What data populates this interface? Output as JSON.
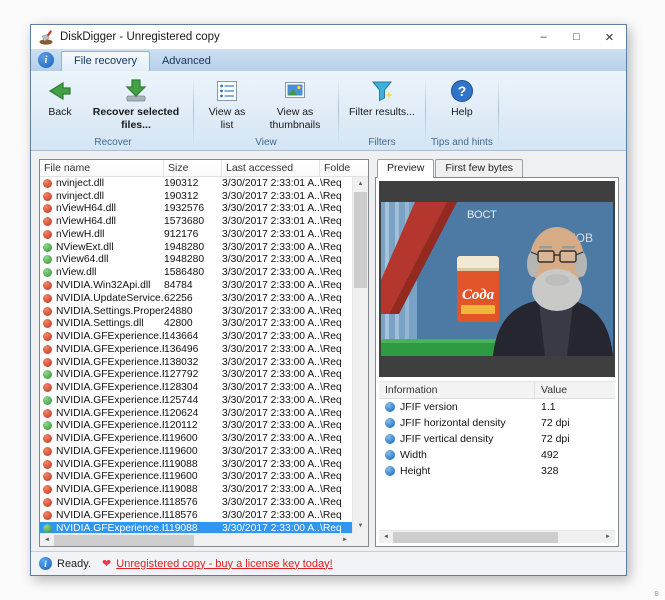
{
  "window": {
    "title": "DiskDigger - Unregistered copy",
    "controls": {
      "minimize": "–",
      "maximize": "□",
      "close": "✕"
    }
  },
  "icons": {
    "info": "i",
    "help": "?",
    "heart": "❤",
    "scroll_up": "▲",
    "scroll_down": "▼",
    "scroll_left": "◄",
    "scroll_right": "►"
  },
  "ribbon": {
    "tabs": [
      {
        "label": "File recovery"
      },
      {
        "label": "Advanced"
      }
    ],
    "groups": [
      {
        "label": "Recover",
        "buttons": [
          {
            "label": "Back"
          },
          {
            "label": "Recover selected files..."
          }
        ]
      },
      {
        "label": "View",
        "buttons": [
          {
            "label": "View as list"
          },
          {
            "label": "View as thumbnails"
          }
        ]
      },
      {
        "label": "Filters",
        "buttons": [
          {
            "label": "Filter results..."
          }
        ]
      },
      {
        "label": "Tips and hints",
        "buttons": [
          {
            "label": "Help"
          }
        ]
      }
    ]
  },
  "file_list": {
    "columns": [
      "File name",
      "Size",
      "Last accessed",
      "Folde"
    ],
    "selected_index": 27,
    "rows": [
      {
        "name": "nvinject.dll",
        "size": "190312",
        "accessed": "3/30/2017 2:33:01 A...",
        "folder": "\\Req",
        "icon": "red"
      },
      {
        "name": "nvinject.dll",
        "size": "190312",
        "accessed": "3/30/2017 2:33:01 A...",
        "folder": "\\Req",
        "icon": "red"
      },
      {
        "name": "nViewH64.dll",
        "size": "1932576",
        "accessed": "3/30/2017 2:33:01 A...",
        "folder": "\\Req",
        "icon": "red"
      },
      {
        "name": "nViewH64.dll",
        "size": "1573680",
        "accessed": "3/30/2017 2:33:01 A...",
        "folder": "\\Req",
        "icon": "red"
      },
      {
        "name": "nViewH.dll",
        "size": "912176",
        "accessed": "3/30/2017 2:33:01 A...",
        "folder": "\\Req",
        "icon": "red"
      },
      {
        "name": "NViewExt.dll",
        "size": "1948280",
        "accessed": "3/30/2017 2:33:00 A...",
        "folder": "\\Req",
        "icon": "green"
      },
      {
        "name": "nView64.dll",
        "size": "1948280",
        "accessed": "3/30/2017 2:33:00 A...",
        "folder": "\\Req",
        "icon": "green"
      },
      {
        "name": "nView.dll",
        "size": "1586480",
        "accessed": "3/30/2017 2:33:00 A...",
        "folder": "\\Req",
        "icon": "green"
      },
      {
        "name": "NVIDIA.Win32Api.dll",
        "size": "84784",
        "accessed": "3/30/2017 2:33:00 A...",
        "folder": "\\Req",
        "icon": "red"
      },
      {
        "name": "NVIDIA.UpdateService.dll",
        "size": "62256",
        "accessed": "3/30/2017 2:33:00 A...",
        "folder": "\\Req",
        "icon": "red"
      },
      {
        "name": "NVIDIA.Settings.Properti...",
        "size": "24880",
        "accessed": "3/30/2017 2:33:00 A...",
        "folder": "\\Req",
        "icon": "red"
      },
      {
        "name": "NVIDIA.Settings.dll",
        "size": "42800",
        "accessed": "3/30/2017 2:33:00 A...",
        "folder": "\\Req",
        "icon": "red"
      },
      {
        "name": "NVIDIA.GFExperience.Re...",
        "size": "143664",
        "accessed": "3/30/2017 2:33:00 A...",
        "folder": "\\Req",
        "icon": "red"
      },
      {
        "name": "NVIDIA.GFExperience.Re...",
        "size": "136496",
        "accessed": "3/30/2017 2:33:00 A...",
        "folder": "\\Req",
        "icon": "red"
      },
      {
        "name": "NVIDIA.GFExperience.Re...",
        "size": "138032",
        "accessed": "3/30/2017 2:33:00 A...",
        "folder": "\\Req",
        "icon": "red"
      },
      {
        "name": "NVIDIA.GFExperience.Re...",
        "size": "127792",
        "accessed": "3/30/2017 2:33:00 A...",
        "folder": "\\Req",
        "icon": "green"
      },
      {
        "name": "NVIDIA.GFExperience.Re...",
        "size": "128304",
        "accessed": "3/30/2017 2:33:00 A...",
        "folder": "\\Req",
        "icon": "red"
      },
      {
        "name": "NVIDIA.GFExperience.Re...",
        "size": "125744",
        "accessed": "3/30/2017 2:33:00 A...",
        "folder": "\\Req",
        "icon": "green"
      },
      {
        "name": "NVIDIA.GFExperience.Re...",
        "size": "120624",
        "accessed": "3/30/2017 2:33:00 A...",
        "folder": "\\Req",
        "icon": "red"
      },
      {
        "name": "NVIDIA.GFExperience.Re...",
        "size": "120112",
        "accessed": "3/30/2017 2:33:00 A...",
        "folder": "\\Req",
        "icon": "green"
      },
      {
        "name": "NVIDIA.GFExperience.Re...",
        "size": "119600",
        "accessed": "3/30/2017 2:33:00 A...",
        "folder": "\\Req",
        "icon": "red"
      },
      {
        "name": "NVIDIA.GFExperience.Re...",
        "size": "119600",
        "accessed": "3/30/2017 2:33:00 A...",
        "folder": "\\Req",
        "icon": "red"
      },
      {
        "name": "NVIDIA.GFExperience.Re...",
        "size": "119088",
        "accessed": "3/30/2017 2:33:00 A...",
        "folder": "\\Req",
        "icon": "red"
      },
      {
        "name": "NVIDIA.GFExperience.Re...",
        "size": "119600",
        "accessed": "3/30/2017 2:33:00 A...",
        "folder": "\\Req",
        "icon": "red"
      },
      {
        "name": "NVIDIA.GFExperience.Re...",
        "size": "119088",
        "accessed": "3/30/2017 2:33:00 A...",
        "folder": "\\Req",
        "icon": "red"
      },
      {
        "name": "NVIDIA.GFExperience.Re...",
        "size": "118576",
        "accessed": "3/30/2017 2:33:00 A...",
        "folder": "\\Req",
        "icon": "red"
      },
      {
        "name": "NVIDIA.GFExperience.Re...",
        "size": "118576",
        "accessed": "3/30/2017 2:33:00 A...",
        "folder": "\\Req",
        "icon": "red"
      },
      {
        "name": "NVIDIA.GFExperience.Re...",
        "size": "119088",
        "accessed": "3/30/2017 2:33:00 A...",
        "folder": "\\Req",
        "icon": "green"
      }
    ]
  },
  "preview": {
    "tabs": [
      "Preview",
      "First few bytes"
    ],
    "image": {
      "box_label": "Сода",
      "bg_text_left": "ВОСТ",
      "bg_text_right": "НОВ"
    },
    "info": {
      "columns": [
        "Information",
        "Value"
      ],
      "rows": [
        {
          "name": "JFIF version",
          "value": "1.1"
        },
        {
          "name": "JFIF horizontal density",
          "value": "72 dpi"
        },
        {
          "name": "JFIF vertical density",
          "value": "72 dpi"
        },
        {
          "name": "Width",
          "value": "492"
        },
        {
          "name": "Height",
          "value": "328"
        }
      ]
    }
  },
  "status_bar": {
    "ready": "Ready.",
    "license": "Unregistered copy - buy a license key today!"
  },
  "artifact": "в"
}
